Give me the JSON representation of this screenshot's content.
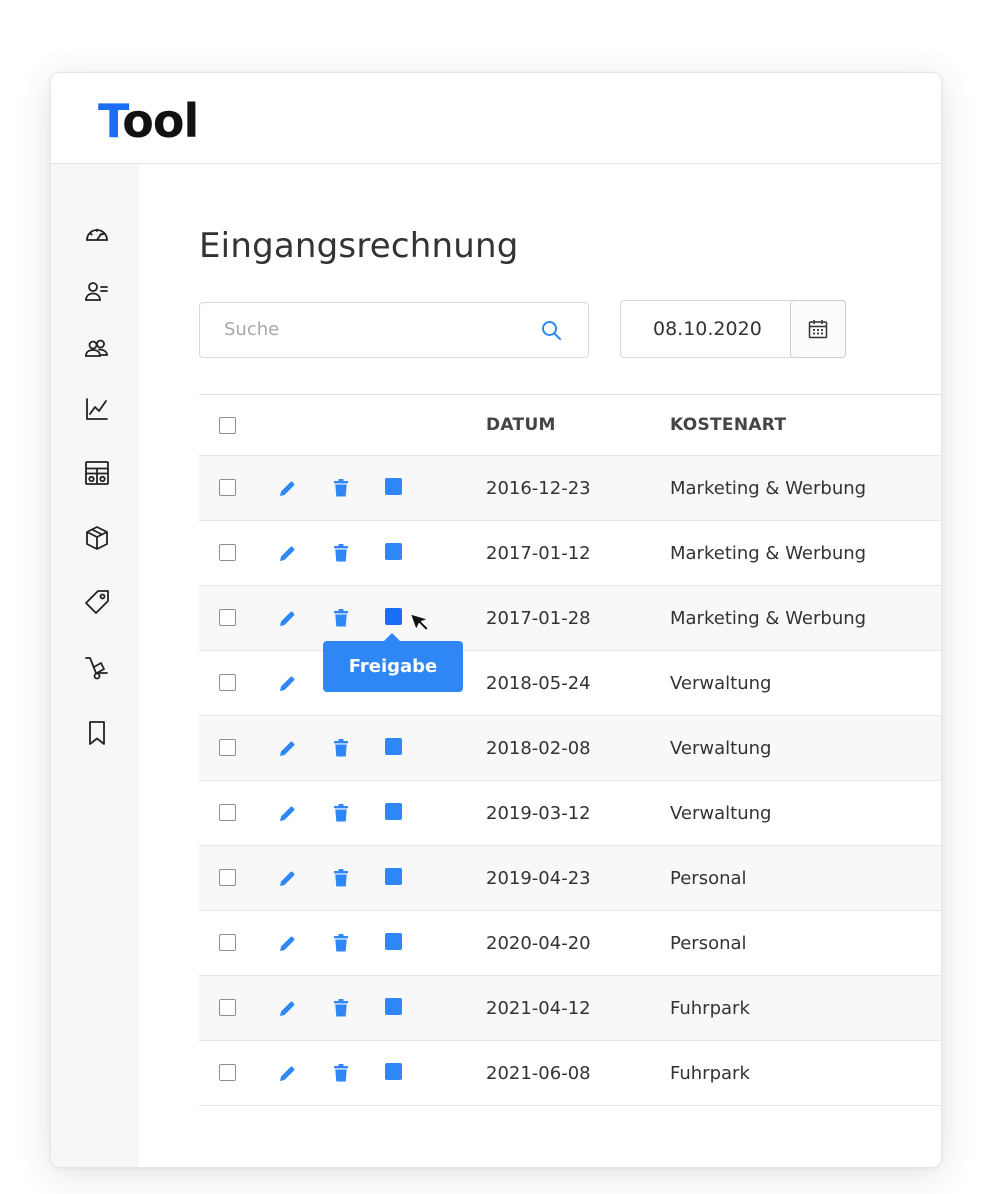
{
  "app": {
    "logo_first": "T",
    "logo_rest": "ool",
    "brand_color": "#1a6ef5",
    "accent_color": "#2f87f5"
  },
  "sidebar": {
    "items": [
      {
        "icon": "dashboard-gauge-icon"
      },
      {
        "icon": "contact-list-icon"
      },
      {
        "icon": "users-group-icon"
      },
      {
        "icon": "line-chart-icon"
      },
      {
        "icon": "cash-register-icon"
      },
      {
        "icon": "package-box-icon"
      },
      {
        "icon": "price-tag-icon"
      },
      {
        "icon": "hand-truck-icon"
      },
      {
        "icon": "bookmark-icon"
      }
    ]
  },
  "page": {
    "title": "Eingangsrechnung"
  },
  "search": {
    "placeholder": "Suche",
    "value": ""
  },
  "date_filter": {
    "value": "08.10.2020"
  },
  "table": {
    "columns": [
      "DATUM",
      "KOSTENART"
    ],
    "rows": [
      {
        "datum": "2016-12-23",
        "kostenart": "Marketing & Werbung"
      },
      {
        "datum": "2017-01-12",
        "kostenart": "Marketing & Werbung"
      },
      {
        "datum": "2017-01-28",
        "kostenart": "Marketing & Werbung"
      },
      {
        "datum": "2018-05-24",
        "kostenart": "Verwaltung"
      },
      {
        "datum": "2018-02-08",
        "kostenart": "Verwaltung"
      },
      {
        "datum": "2019-03-12",
        "kostenart": "Verwaltung"
      },
      {
        "datum": "2019-04-23",
        "kostenart": "Personal"
      },
      {
        "datum": "2020-04-20",
        "kostenart": "Personal"
      },
      {
        "datum": "2021-04-12",
        "kostenart": "Fuhrpark"
      },
      {
        "datum": "2021-06-08",
        "kostenart": "Fuhrpark"
      }
    ]
  },
  "tooltip": {
    "label": "Freigabe"
  }
}
